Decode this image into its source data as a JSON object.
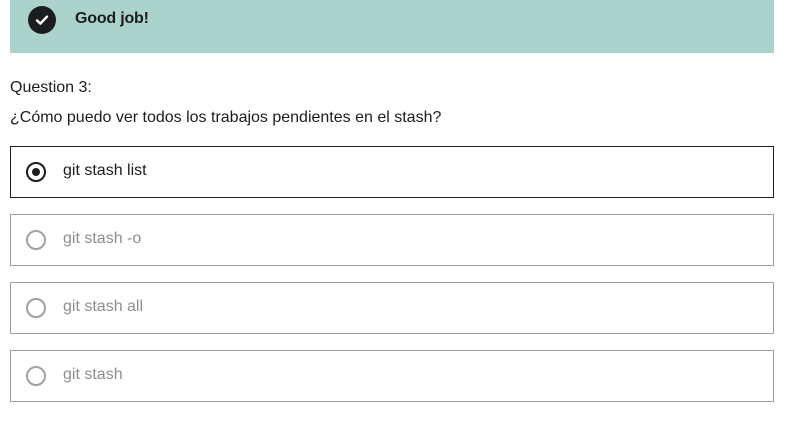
{
  "feedback": {
    "status": "correct",
    "message": "Good job!",
    "icon": "check-circle-icon",
    "background_color": "#acd2cc"
  },
  "question": {
    "number_label": "Question 3:",
    "text": "¿Cómo puedo ver todos los trabajos pendientes en el stash?"
  },
  "answers": [
    {
      "label": "git stash list",
      "selected": true
    },
    {
      "label": "git stash -o",
      "selected": false
    },
    {
      "label": "git stash all",
      "selected": false
    },
    {
      "label": "git stash",
      "selected": false
    }
  ]
}
